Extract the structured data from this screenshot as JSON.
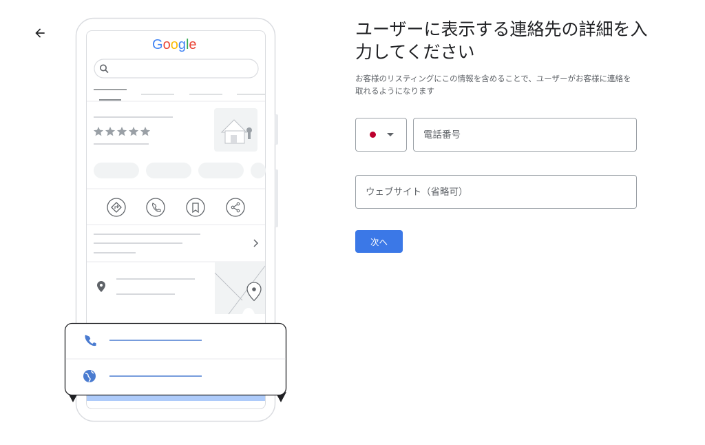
{
  "header": {
    "back_icon": "arrow-left-icon",
    "title": "ユーザーに表示する連絡先の詳細を入力してください",
    "subtitle": "お客様のリスティングにこの情報を含めることで、ユーザーがお客様に連絡を取れるようになります"
  },
  "illustration": {
    "logo_text": "Google",
    "logo_colors": [
      "#4285F4",
      "#EA4335",
      "#FBBC05",
      "#4285F4",
      "#34A853",
      "#EA4335"
    ],
    "star_count": 5,
    "action_icons": [
      "directions-icon",
      "phone-icon",
      "bookmark-icon",
      "share-icon"
    ]
  },
  "form": {
    "country": {
      "flag": "japan-flag",
      "flag_color": "#bc002d"
    },
    "phone_placeholder": "電話番号",
    "website_placeholder": "ウェブサイト（省略可）",
    "next_label": "次へ"
  },
  "colors": {
    "accent": "#3b78e7",
    "link_line": "#4a7bd0",
    "highlight_bar": "#aecbfa"
  }
}
